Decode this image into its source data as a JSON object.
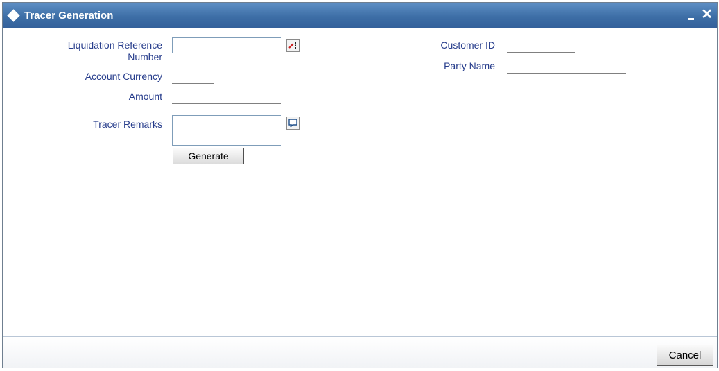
{
  "window": {
    "title": "Tracer Generation",
    "icons": {
      "title": "diamond-icon",
      "minimize": "minimize-icon",
      "close": "close-icon",
      "close_glyph": "✕"
    },
    "colors": {
      "titlebar": "#3d6ea6",
      "label": "#273d8c"
    }
  },
  "form": {
    "liquidation_ref_label_line1": "Liquidation Reference",
    "liquidation_ref_label_line2": "Number",
    "liquidation_ref_value": "",
    "account_currency_label": "Account Currency",
    "account_currency_value": "",
    "amount_label": "Amount",
    "amount_value": "",
    "tracer_remarks_label": "Tracer Remarks",
    "tracer_remarks_value": "",
    "generate_label": "Generate",
    "customer_id_label": "Customer ID",
    "customer_id_value": "",
    "party_name_label": "Party Name",
    "party_name_value": ""
  },
  "footer": {
    "cancel_label": "Cancel"
  }
}
